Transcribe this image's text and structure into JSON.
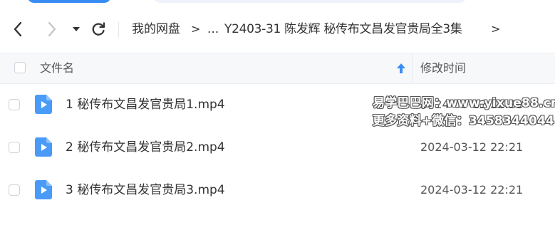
{
  "navigation": {
    "back_icon": "chevron-left-icon",
    "forward_icon": "chevron-right-icon",
    "dropdown_icon": "caret-down-icon",
    "refresh_icon": "refresh-icon"
  },
  "breadcrumb": {
    "items": [
      "我的网盘",
      "...",
      "Y2403-31 陈发辉 秘传布文昌发官贵局全3集"
    ],
    "separator": ">"
  },
  "file_list": {
    "header": {
      "name_label": "文件名",
      "time_label": "修改时间",
      "sort_icon": "sort-up-arrow-icon"
    },
    "rows": [
      {
        "name": "1 秘传布文昌发官贵局1.mp4",
        "modified": "2024-03-12 22:21",
        "icon": "video-file-icon"
      },
      {
        "name": "2 秘传布文昌发官贵局2.mp4",
        "modified": "2024-03-12 22:21",
        "icon": "video-file-icon"
      },
      {
        "name": "3 秘传布文昌发官贵局3.mp4",
        "modified": "2024-03-12 22:21",
        "icon": "video-file-icon"
      }
    ]
  },
  "watermark": {
    "line1": "易学巴巴网：www.yixue88.cn",
    "line2": "更多资料+微信：3458344044"
  },
  "colors": {
    "accent": "#3a8cf5",
    "video_icon": "#4a9bf7",
    "header_bg": "#f7f8fa"
  }
}
